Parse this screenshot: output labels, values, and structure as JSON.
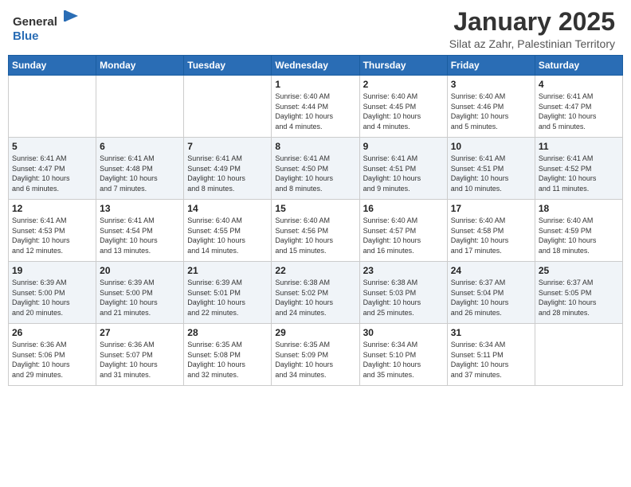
{
  "header": {
    "logo_general": "General",
    "logo_blue": "Blue",
    "main_title": "January 2025",
    "subtitle": "Silat az Zahr, Palestinian Territory"
  },
  "weekdays": [
    "Sunday",
    "Monday",
    "Tuesday",
    "Wednesday",
    "Thursday",
    "Friday",
    "Saturday"
  ],
  "weeks": [
    [
      {
        "num": "",
        "info": ""
      },
      {
        "num": "",
        "info": ""
      },
      {
        "num": "",
        "info": ""
      },
      {
        "num": "1",
        "info": "Sunrise: 6:40 AM\nSunset: 4:44 PM\nDaylight: 10 hours\nand 4 minutes."
      },
      {
        "num": "2",
        "info": "Sunrise: 6:40 AM\nSunset: 4:45 PM\nDaylight: 10 hours\nand 4 minutes."
      },
      {
        "num": "3",
        "info": "Sunrise: 6:40 AM\nSunset: 4:46 PM\nDaylight: 10 hours\nand 5 minutes."
      },
      {
        "num": "4",
        "info": "Sunrise: 6:41 AM\nSunset: 4:47 PM\nDaylight: 10 hours\nand 5 minutes."
      }
    ],
    [
      {
        "num": "5",
        "info": "Sunrise: 6:41 AM\nSunset: 4:47 PM\nDaylight: 10 hours\nand 6 minutes."
      },
      {
        "num": "6",
        "info": "Sunrise: 6:41 AM\nSunset: 4:48 PM\nDaylight: 10 hours\nand 7 minutes."
      },
      {
        "num": "7",
        "info": "Sunrise: 6:41 AM\nSunset: 4:49 PM\nDaylight: 10 hours\nand 8 minutes."
      },
      {
        "num": "8",
        "info": "Sunrise: 6:41 AM\nSunset: 4:50 PM\nDaylight: 10 hours\nand 8 minutes."
      },
      {
        "num": "9",
        "info": "Sunrise: 6:41 AM\nSunset: 4:51 PM\nDaylight: 10 hours\nand 9 minutes."
      },
      {
        "num": "10",
        "info": "Sunrise: 6:41 AM\nSunset: 4:51 PM\nDaylight: 10 hours\nand 10 minutes."
      },
      {
        "num": "11",
        "info": "Sunrise: 6:41 AM\nSunset: 4:52 PM\nDaylight: 10 hours\nand 11 minutes."
      }
    ],
    [
      {
        "num": "12",
        "info": "Sunrise: 6:41 AM\nSunset: 4:53 PM\nDaylight: 10 hours\nand 12 minutes."
      },
      {
        "num": "13",
        "info": "Sunrise: 6:41 AM\nSunset: 4:54 PM\nDaylight: 10 hours\nand 13 minutes."
      },
      {
        "num": "14",
        "info": "Sunrise: 6:40 AM\nSunset: 4:55 PM\nDaylight: 10 hours\nand 14 minutes."
      },
      {
        "num": "15",
        "info": "Sunrise: 6:40 AM\nSunset: 4:56 PM\nDaylight: 10 hours\nand 15 minutes."
      },
      {
        "num": "16",
        "info": "Sunrise: 6:40 AM\nSunset: 4:57 PM\nDaylight: 10 hours\nand 16 minutes."
      },
      {
        "num": "17",
        "info": "Sunrise: 6:40 AM\nSunset: 4:58 PM\nDaylight: 10 hours\nand 17 minutes."
      },
      {
        "num": "18",
        "info": "Sunrise: 6:40 AM\nSunset: 4:59 PM\nDaylight: 10 hours\nand 18 minutes."
      }
    ],
    [
      {
        "num": "19",
        "info": "Sunrise: 6:39 AM\nSunset: 5:00 PM\nDaylight: 10 hours\nand 20 minutes."
      },
      {
        "num": "20",
        "info": "Sunrise: 6:39 AM\nSunset: 5:00 PM\nDaylight: 10 hours\nand 21 minutes."
      },
      {
        "num": "21",
        "info": "Sunrise: 6:39 AM\nSunset: 5:01 PM\nDaylight: 10 hours\nand 22 minutes."
      },
      {
        "num": "22",
        "info": "Sunrise: 6:38 AM\nSunset: 5:02 PM\nDaylight: 10 hours\nand 24 minutes."
      },
      {
        "num": "23",
        "info": "Sunrise: 6:38 AM\nSunset: 5:03 PM\nDaylight: 10 hours\nand 25 minutes."
      },
      {
        "num": "24",
        "info": "Sunrise: 6:37 AM\nSunset: 5:04 PM\nDaylight: 10 hours\nand 26 minutes."
      },
      {
        "num": "25",
        "info": "Sunrise: 6:37 AM\nSunset: 5:05 PM\nDaylight: 10 hours\nand 28 minutes."
      }
    ],
    [
      {
        "num": "26",
        "info": "Sunrise: 6:36 AM\nSunset: 5:06 PM\nDaylight: 10 hours\nand 29 minutes."
      },
      {
        "num": "27",
        "info": "Sunrise: 6:36 AM\nSunset: 5:07 PM\nDaylight: 10 hours\nand 31 minutes."
      },
      {
        "num": "28",
        "info": "Sunrise: 6:35 AM\nSunset: 5:08 PM\nDaylight: 10 hours\nand 32 minutes."
      },
      {
        "num": "29",
        "info": "Sunrise: 6:35 AM\nSunset: 5:09 PM\nDaylight: 10 hours\nand 34 minutes."
      },
      {
        "num": "30",
        "info": "Sunrise: 6:34 AM\nSunset: 5:10 PM\nDaylight: 10 hours\nand 35 minutes."
      },
      {
        "num": "31",
        "info": "Sunrise: 6:34 AM\nSunset: 5:11 PM\nDaylight: 10 hours\nand 37 minutes."
      },
      {
        "num": "",
        "info": ""
      }
    ]
  ]
}
